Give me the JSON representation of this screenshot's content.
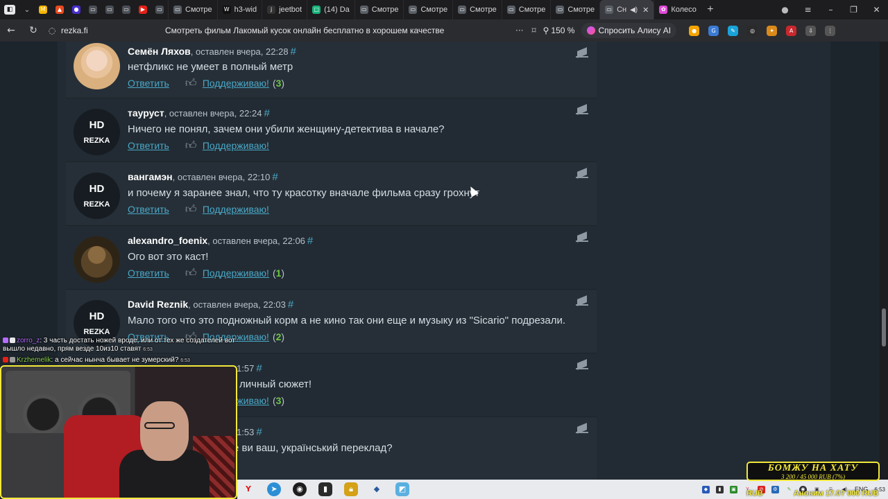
{
  "browser": {
    "tabs": [
      {
        "label": "Смотре",
        "fav": "#5a5f66",
        "active": false
      },
      {
        "label": "h3-wid",
        "fav": "#111111",
        "active": false
      },
      {
        "label": "jeetbot",
        "fav": "#333333",
        "active": false
      },
      {
        "label": "(14) Da",
        "fav": "#17b37a",
        "active": false
      },
      {
        "label": "Смотре",
        "fav": "#5a5f66",
        "active": false
      },
      {
        "label": "Смотре",
        "fav": "#5a5f66",
        "active": false
      },
      {
        "label": "Смотре",
        "fav": "#5a5f66",
        "active": false
      },
      {
        "label": "Смотре",
        "fav": "#5a5f66",
        "active": false
      },
      {
        "label": "Смотре",
        "fav": "#5a5f66",
        "active": false
      },
      {
        "label": "Сн",
        "fav": "#5a5f66",
        "active": true
      },
      {
        "label": "Колесо",
        "fav": "#e04ad6",
        "active": false
      }
    ],
    "url_domain": "rezka.fi",
    "page_title": "Смотреть фильм Лакомый кусок онлайн бесплатно в хорошем качестве",
    "zoom": "150 %",
    "alisa_label": "Спросить Алису AI"
  },
  "comments": [
    {
      "avatar": "woman",
      "name": "Семён Ляхов",
      "meta": ", оставлен вчера, 22:28",
      "text": "нетфликс не умеет в полный метр",
      "support_count": "3"
    },
    {
      "avatar": "hd",
      "name": "тауруст",
      "meta": ", оставлен вчера, 22:24",
      "text": "Ничего не понял, зачем они убили женщину-детектива в начале?",
      "support_count": ""
    },
    {
      "avatar": "hd",
      "name": "вангамэн",
      "meta": ", оставлен вчера, 22:10",
      "text": "и почему я заранее знал, что ту красотку вначале фильма сразу грохнут",
      "support_count": ""
    },
    {
      "avatar": "owl",
      "name": "alexandro_foenix",
      "meta": ", оставлен вчера, 22:06",
      "text": "Ого вот это каст!",
      "support_count": "1"
    },
    {
      "avatar": "hd",
      "name": "David Reznik",
      "meta": ", оставлен вчера, 22:03",
      "text": "Мало того что это подножный корм а не кино так они еще и музыку из \"Sicario\" подрезали.",
      "support_count": "2"
    },
    {
      "avatar": "hd",
      "name": "",
      "meta": "1:57",
      "text": "личный сюжет!",
      "support_count": "3"
    },
    {
      "avatar": "hd",
      "name": "",
      "meta": "1:53",
      "text": "е ви ваш, український переклад?",
      "support_count": ""
    }
  ],
  "labels": {
    "reply": "Ответить",
    "support": "Поддерживаю!",
    "hash": "#",
    "hd_top": "HD",
    "hd_bottom": "REZKA"
  },
  "stream": {
    "chat": [
      {
        "user": "zorro_z",
        "text": ": 3 часть достать ножей вроде, или от тех же создателей вот вышло недавно, прям везде 10из10 ставят",
        "time": "6:53"
      },
      {
        "user": "Krzhemelik",
        "text": ": а сейчас нынча бывает не зумерский?",
        "time": "6:53"
      }
    ],
    "donate_title": "БОМЖУ НА ХАТУ",
    "donate_progress": "3 200 / 45 000 RUB (7%)",
    "rub_left": "RUB",
    "rub_right": "Аноним 17.0? 000 RUB"
  },
  "taskbar": {
    "lang": "ENG",
    "time": "6:53"
  }
}
